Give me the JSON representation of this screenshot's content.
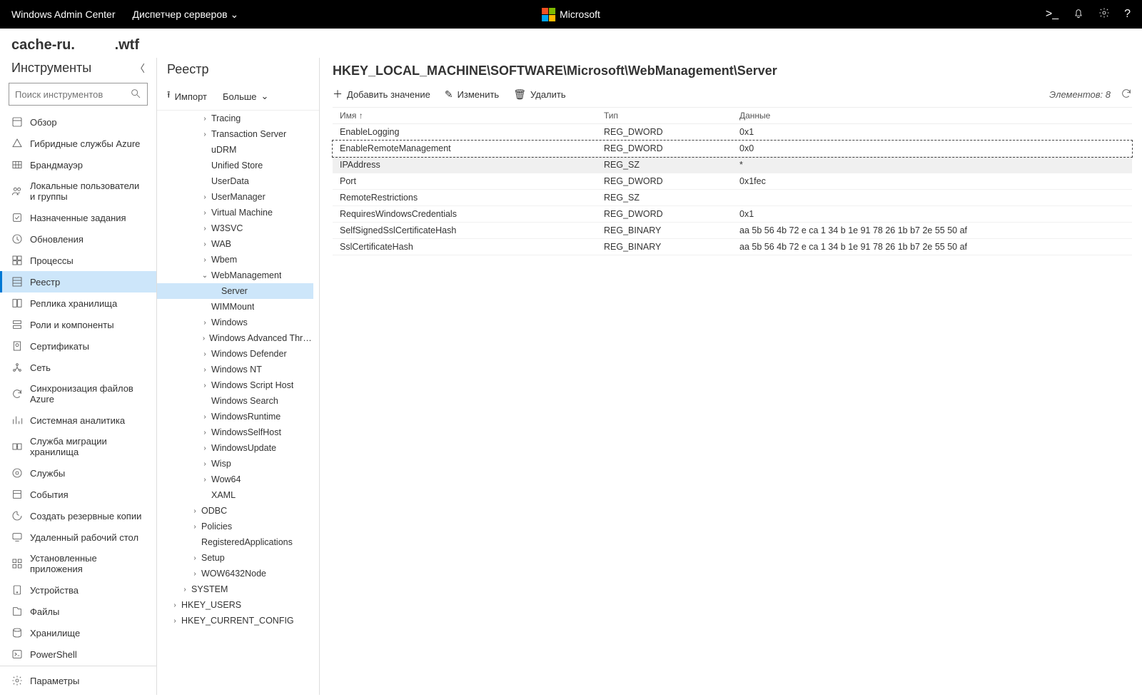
{
  "topbar": {
    "title": "Windows Admin Center",
    "dropdown": "Диспетчер серверов",
    "brand": "Microsoft"
  },
  "hostname_prefix": "cache-ru.",
  "hostname_suffix": ".wtf",
  "tools": {
    "heading": "Инструменты",
    "search_placeholder": "Поиск инструментов",
    "items": [
      {
        "label": "Обзор",
        "icon": "overview"
      },
      {
        "label": "Гибридные службы Azure",
        "icon": "azure"
      },
      {
        "label": "Брандмауэр",
        "icon": "firewall"
      },
      {
        "label": "Локальные пользователи и группы",
        "icon": "users"
      },
      {
        "label": "Назначенные задания",
        "icon": "tasks"
      },
      {
        "label": "Обновления",
        "icon": "updates"
      },
      {
        "label": "Процессы",
        "icon": "processes"
      },
      {
        "label": "Реестр",
        "icon": "registry",
        "selected": true
      },
      {
        "label": "Реплика хранилища",
        "icon": "replica"
      },
      {
        "label": "Роли и компоненты",
        "icon": "roles"
      },
      {
        "label": "Сертификаты",
        "icon": "certs"
      },
      {
        "label": "Сеть",
        "icon": "network"
      },
      {
        "label": "Синхронизация файлов Azure",
        "icon": "sync"
      },
      {
        "label": "Системная аналитика",
        "icon": "analytics"
      },
      {
        "label": "Служба миграции хранилища",
        "icon": "migration"
      },
      {
        "label": "Службы",
        "icon": "services"
      },
      {
        "label": "События",
        "icon": "events"
      },
      {
        "label": "Создать резервные копии",
        "icon": "backup"
      },
      {
        "label": "Удаленный рабочий стол",
        "icon": "rdp"
      },
      {
        "label": "Установленные приложения",
        "icon": "apps"
      },
      {
        "label": "Устройства",
        "icon": "devices"
      },
      {
        "label": "Файлы",
        "icon": "files"
      },
      {
        "label": "Хранилище",
        "icon": "storage"
      },
      {
        "label": "PowerShell",
        "icon": "ps"
      }
    ],
    "footer": "Параметры"
  },
  "tree": {
    "heading": "Реестр",
    "import": "Импорт",
    "more": "Больше",
    "items": [
      {
        "label": "Tracing",
        "indent": 3,
        "expandable": true
      },
      {
        "label": "Transaction Server",
        "indent": 3,
        "expandable": true
      },
      {
        "label": "uDRM",
        "indent": 3,
        "expandable": false
      },
      {
        "label": "Unified Store",
        "indent": 3,
        "expandable": false
      },
      {
        "label": "UserData",
        "indent": 3,
        "expandable": false
      },
      {
        "label": "UserManager",
        "indent": 3,
        "expandable": true
      },
      {
        "label": "Virtual Machine",
        "indent": 3,
        "expandable": true
      },
      {
        "label": "W3SVC",
        "indent": 3,
        "expandable": true
      },
      {
        "label": "WAB",
        "indent": 3,
        "expandable": true
      },
      {
        "label": "Wbem",
        "indent": 3,
        "expandable": true
      },
      {
        "label": "WebManagement",
        "indent": 3,
        "expandable": true,
        "expanded": true
      },
      {
        "label": "Server",
        "indent": 4,
        "expandable": false,
        "selected": true
      },
      {
        "label": "WIMMount",
        "indent": 3,
        "expandable": false
      },
      {
        "label": "Windows",
        "indent": 3,
        "expandable": true
      },
      {
        "label": "Windows Advanced Threat Protection",
        "indent": 3,
        "expandable": true
      },
      {
        "label": "Windows Defender",
        "indent": 3,
        "expandable": true
      },
      {
        "label": "Windows NT",
        "indent": 3,
        "expandable": true
      },
      {
        "label": "Windows Script Host",
        "indent": 3,
        "expandable": true
      },
      {
        "label": "Windows Search",
        "indent": 3,
        "expandable": false
      },
      {
        "label": "WindowsRuntime",
        "indent": 3,
        "expandable": true
      },
      {
        "label": "WindowsSelfHost",
        "indent": 3,
        "expandable": true
      },
      {
        "label": "WindowsUpdate",
        "indent": 3,
        "expandable": true
      },
      {
        "label": "Wisp",
        "indent": 3,
        "expandable": true
      },
      {
        "label": "Wow64",
        "indent": 3,
        "expandable": true
      },
      {
        "label": "XAML",
        "indent": 3,
        "expandable": false
      },
      {
        "label": "ODBC",
        "indent": 2,
        "expandable": true
      },
      {
        "label": "Policies",
        "indent": 2,
        "expandable": true
      },
      {
        "label": "RegisteredApplications",
        "indent": 2,
        "expandable": false
      },
      {
        "label": "Setup",
        "indent": 2,
        "expandable": true
      },
      {
        "label": "WOW6432Node",
        "indent": 2,
        "expandable": true
      },
      {
        "label": "SYSTEM",
        "indent": 1,
        "expandable": true
      },
      {
        "label": "HKEY_USERS",
        "indent": 0,
        "expandable": true
      },
      {
        "label": "HKEY_CURRENT_CONFIG",
        "indent": 0,
        "expandable": true
      }
    ]
  },
  "registry": {
    "path": "HKEY_LOCAL_MACHINE\\SOFTWARE\\Microsoft\\WebManagement\\Server",
    "actions": {
      "add": "Добавить значение",
      "edit": "Изменить",
      "delete": "Удалить"
    },
    "count_label": "Элементов: 8",
    "cols": {
      "name": "Имя",
      "type": "Тип",
      "data": "Данные"
    },
    "rows": [
      {
        "name": "EnableLogging",
        "type": "REG_DWORD",
        "data": "0x1"
      },
      {
        "name": "EnableRemoteManagement",
        "type": "REG_DWORD",
        "data": "0x0",
        "selected": true
      },
      {
        "name": "IPAddress",
        "type": "REG_SZ",
        "data": "*",
        "hover": true
      },
      {
        "name": "Port",
        "type": "REG_DWORD",
        "data": "0x1fec"
      },
      {
        "name": "RemoteRestrictions",
        "type": "REG_SZ",
        "data": ""
      },
      {
        "name": "RequiresWindowsCredentials",
        "type": "REG_DWORD",
        "data": "0x1"
      },
      {
        "name": "SelfSignedSslCertificateHash",
        "type": "REG_BINARY",
        "data": "aa 5b 56 4b 72 e ca 1 34 b 1e 91 78 26 1b b7 2e 55 50 af"
      },
      {
        "name": "SslCertificateHash",
        "type": "REG_BINARY",
        "data": "aa 5b 56 4b 72 e ca 1 34 b 1e 91 78 26 1b b7 2e 55 50 af"
      }
    ]
  }
}
